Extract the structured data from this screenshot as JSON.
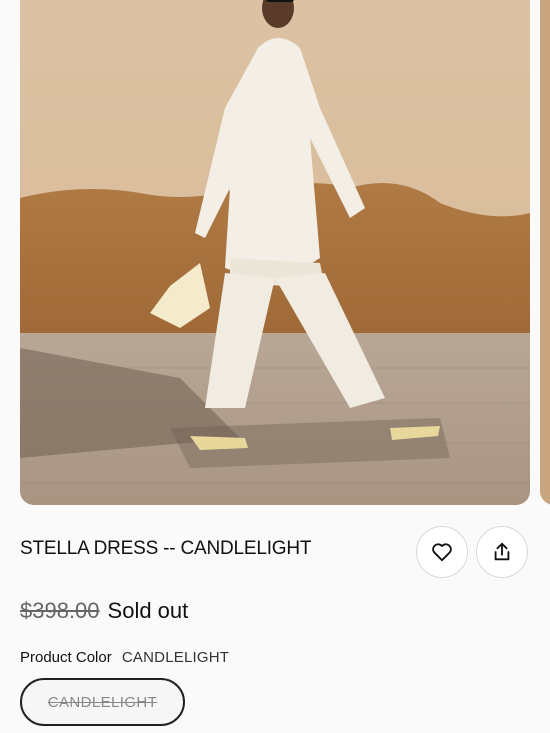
{
  "product": {
    "title": "STELLA DRESS -- CANDLELIGHT",
    "price_original": "$398.00",
    "availability": "Sold out",
    "color_label": "Product Color",
    "color_value": "CANDLELIGHT",
    "swatches": [
      {
        "label": "CANDLELIGHT",
        "available": false,
        "selected": true
      }
    ]
  },
  "icons": {
    "favorite": "heart-icon",
    "share": "share-icon"
  },
  "colors": {
    "background": "#fafafa",
    "text": "#111111",
    "muted": "#666666"
  }
}
